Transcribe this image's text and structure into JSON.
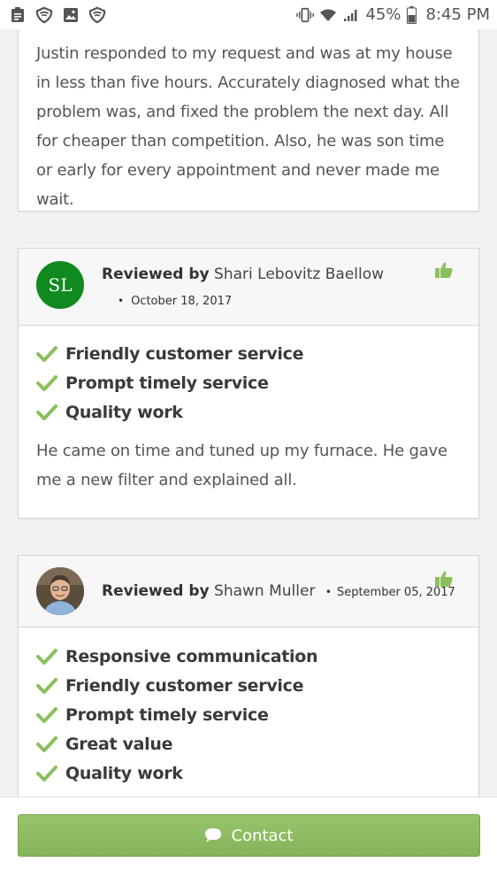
{
  "status_bar": {
    "battery": "45%",
    "time": "8:45 PM"
  },
  "reviews": [
    {
      "text": "Justin responded to my request and was at my house in less than five hours. Accurately diagnosed what the problem was, and fixed the problem the next day. All for cheaper than competition. Also, he was son time or early for every appointment and never made me wait."
    },
    {
      "reviewed_by": "Reviewed by",
      "name": "Shari Lebovitz Baellow",
      "initials": "SL",
      "date": "October 18, 2017",
      "tags": [
        "Friendly customer service",
        "Prompt timely service",
        "Quality work"
      ],
      "text": "He came on time and tuned up my furnace. He gave me a new filter and explained all."
    },
    {
      "reviewed_by": "Reviewed by",
      "name": "Shawn Muller",
      "date": "September 05, 2017",
      "tags": [
        "Responsive communication",
        "Friendly customer service",
        "Prompt timely service",
        "Great value",
        "Quality work"
      ]
    }
  ],
  "contact_button": {
    "label": "Contact"
  },
  "colors": {
    "accent_green": "#85b45a",
    "avatar_green": "#0e8a1e",
    "check_green": "#8bbf5c"
  },
  "icons": {
    "status_left": [
      "clipboard-icon",
      "shield-icon",
      "image-icon",
      "shield-icon"
    ],
    "status_right": [
      "vibrate-icon",
      "wifi-icon",
      "signal-icon",
      "battery-icon"
    ],
    "check": "check-icon",
    "thumb": "thumbs-up-icon",
    "contact": "chat-bubble-icon"
  }
}
